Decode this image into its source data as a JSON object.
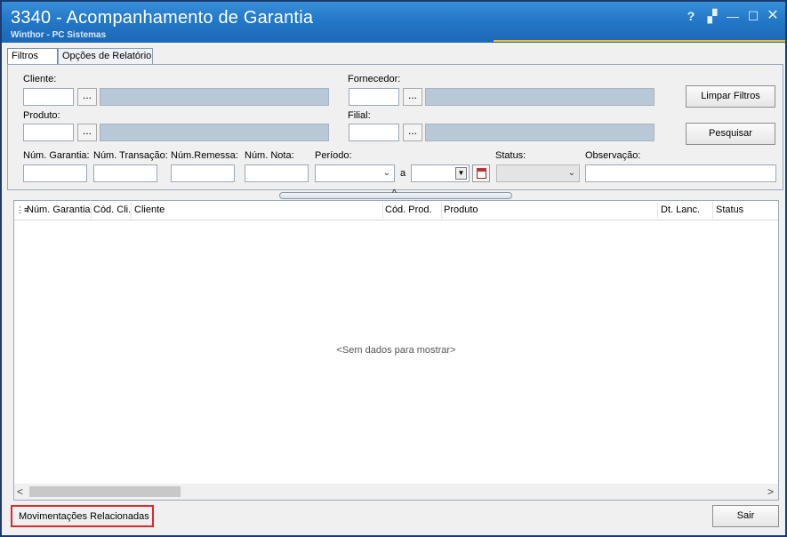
{
  "window": {
    "title": "3340 - Acompanhamento de Garantia",
    "subtitle": "Winthor - PC Sistemas",
    "controls": {
      "help": "?",
      "restore": "▞",
      "minimize": "—",
      "maximize": "☐",
      "close": "✕"
    }
  },
  "tabs": [
    {
      "label": "Filtros",
      "active": true
    },
    {
      "label": "Opções de Relatório",
      "active": false
    }
  ],
  "filters": {
    "cliente_label": "Cliente:",
    "fornecedor_label": "Fornecedor:",
    "produto_label": "Produto:",
    "filial_label": "Filial:",
    "lookup_button": "...",
    "num_garantia_label": "Núm. Garantia:",
    "num_transacao_label": "Núm. Transação:",
    "num_remessa_label": "Núm.Remessa:",
    "num_nota_label": "Núm. Nota:",
    "periodo_label": "Período:",
    "periodo_separator": "a",
    "status_label": "Status:",
    "observacao_label": "Observação:"
  },
  "actions": {
    "limpar_filtros": "Limpar Filtros",
    "pesquisar": "Pesquisar"
  },
  "grid": {
    "columns": [
      "Núm. Garantia",
      "Cód. Cli.",
      "Cliente",
      "Cód. Prod.",
      "Produto",
      "Dt. Lanc.",
      "Status"
    ],
    "empty_text": "<Sem dados para mostrar>"
  },
  "footer": {
    "movimentacoes": "Movimentações Relacionadas",
    "sair": "Sair"
  },
  "colors": {
    "titlebar": "#2378c8",
    "accent_line": "#e6c31e",
    "highlight_border": "#e02828",
    "readonly_field": "#b9c8d6"
  }
}
